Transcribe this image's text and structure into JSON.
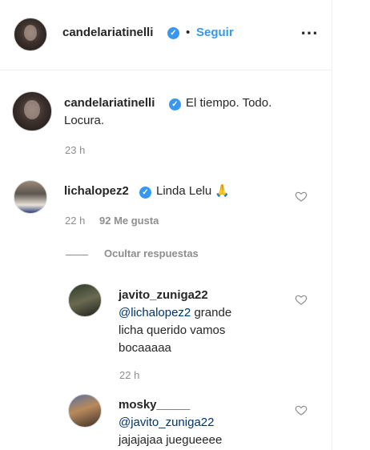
{
  "header": {
    "username": "candelariatinelli",
    "separator": "•",
    "follow_label": "Seguir",
    "more_icon": "⋯"
  },
  "caption": {
    "username": "candelariatinelli",
    "text": "El tiempo. Todo. Locura.",
    "time": "23 h"
  },
  "comment": {
    "username": "lichalopez2",
    "text": "Linda Lelu",
    "emoji": "🙏",
    "time": "22 h",
    "likes": "92 Me gusta"
  },
  "replies_toggle": "Ocultar respuestas",
  "replies": [
    {
      "username": "javito_zuniga22",
      "mention": "@lichalopez2",
      "text_line1": " grande",
      "text_line2": "licha querido vamos",
      "text_line3": "bocaaaaa",
      "time": "22 h"
    },
    {
      "username": "mosky_____",
      "mention": "@javito_zuniga22",
      "text_line2": "jajajajaa juegueeee"
    }
  ],
  "colors": {
    "link_blue": "#3897f0",
    "mention_blue": "#003569",
    "meta_gray": "#8e8e8e"
  },
  "icons": [
    "verified-badge-icon",
    "more-options-icon",
    "heart-icon"
  ]
}
